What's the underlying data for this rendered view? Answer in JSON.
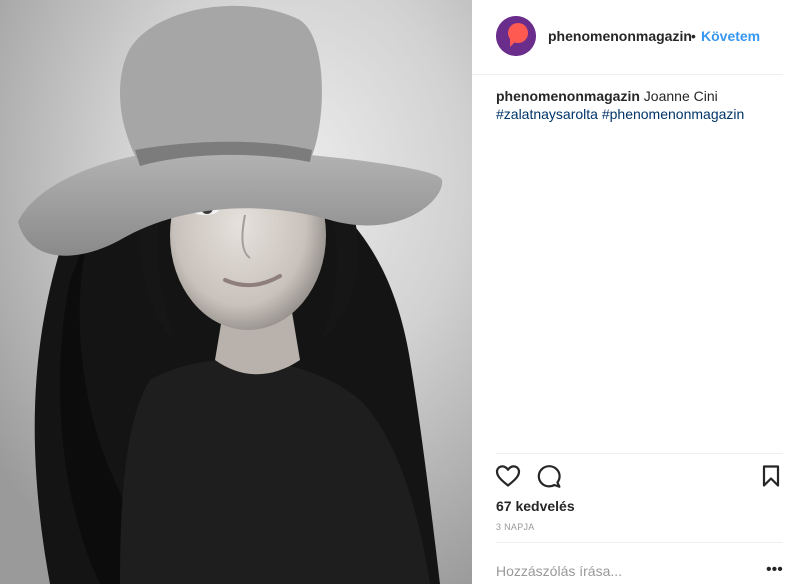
{
  "post": {
    "photo_alt": "Black and white portrait",
    "header": {
      "username": "phenomenonmagazin",
      "separator": "•",
      "follow_label": "Követem"
    },
    "caption": {
      "username": "phenomenonmagazin",
      "text": "Joanne Cini",
      "hashtags": [
        "#zalatnaysarolta",
        "#phenomenonmagazin"
      ]
    },
    "likes": "67 kedvelés",
    "timestamp": "3 NAPJA",
    "comment_placeholder": "Hozzászólás írása...",
    "more_label": "•••"
  },
  "colors": {
    "link_blue": "#3897f0",
    "hashtag_blue": "#003569",
    "avatar_purple": "#6b2d8c",
    "avatar_mark": "#ff5a52",
    "muted_gray": "#999999",
    "border": "#efefef"
  },
  "icons": {
    "like": "heart-outline-icon",
    "comment": "speech-bubble-icon",
    "save": "bookmark-icon",
    "more": "ellipsis-icon"
  }
}
